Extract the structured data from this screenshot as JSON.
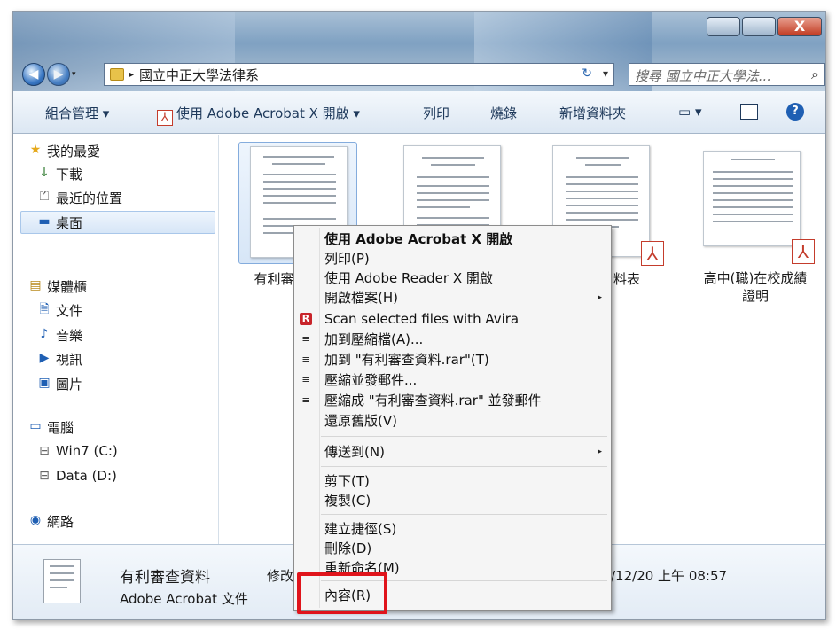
{
  "window": {
    "nav": {
      "back": "◀",
      "forward": "▶"
    },
    "address": {
      "arrow": "▸",
      "path": "國立中正大學法律系",
      "refresh": "↻",
      "dropdown": "▾"
    },
    "search": {
      "placeholder": "搜尋 國立中正大學法...",
      "icon": "search-icon",
      "glyph": "⌕"
    },
    "controls": {
      "minimize": "",
      "maximize": "",
      "close": "X"
    }
  },
  "toolbar": {
    "organize": "組合管理 ▾",
    "open_with": "使用 Adobe Acrobat X 開啟 ▾",
    "pdf_glyph": "⅄",
    "print": "列印",
    "burn": "燒錄",
    "new_folder": "新增資料夾",
    "views": "▭ ▾",
    "help": "?"
  },
  "sidebar": {
    "favorites": {
      "label": "我的最愛",
      "icon": "star-icon",
      "glyph": "★"
    },
    "downloads": {
      "label": "下載",
      "glyph": "↓"
    },
    "recent": {
      "label": "最近的位置",
      "glyph": "⏍"
    },
    "desktop": {
      "label": "桌面",
      "glyph": "▬"
    },
    "libraries": {
      "label": "媒體櫃",
      "glyph": "▤"
    },
    "documents": {
      "label": "文件",
      "glyph": "🗎"
    },
    "music": {
      "label": "音樂",
      "glyph": "♪"
    },
    "videos": {
      "label": "視訊",
      "glyph": "▶"
    },
    "pictures": {
      "label": "圖片",
      "glyph": "▣"
    },
    "computer": {
      "label": "電腦",
      "glyph": "▭"
    },
    "drive_c": {
      "label": "Win7 (C:)",
      "glyph": "⊟"
    },
    "drive_d": {
      "label": "Data (D:)",
      "glyph": "⊟"
    },
    "network": {
      "label": "網路",
      "glyph": "◉"
    }
  },
  "files": [
    {
      "label": "有利審",
      "selected": true
    },
    {
      "label": "",
      "selected": false
    },
    {
      "label": "料表",
      "selected": false
    },
    {
      "label_line1": "高中(職)在校成績",
      "label_line2": "證明",
      "selected": false
    }
  ],
  "pdf_badge": "⅄",
  "details": {
    "name": "有利審查資料",
    "type": "Adobe Acrobat 文件",
    "modified_label": "修改",
    "date": "/12/20 上午 08:57"
  },
  "context_menu": {
    "open_acrobat": "使用 Adobe Acrobat X 開啟",
    "print": "列印(P)",
    "open_reader": "使用 Adobe Reader X 開啟",
    "open_with": "開啟檔案(H)",
    "avira": "Scan selected files with Avira",
    "add_archive": "加到壓縮檔(A)...",
    "add_rar": "加到 \"有利審查資料.rar\"(T)",
    "compress_email": "壓縮並發郵件...",
    "compress_rar_email": "壓縮成 \"有利審查資料.rar\" 並發郵件",
    "restore": "還原舊版(V)",
    "send_to": "傳送到(N)",
    "cut": "剪下(T)",
    "copy": "複製(C)",
    "shortcut": "建立捷徑(S)",
    "delete": "刪除(D)",
    "rename": "重新命名(M)",
    "properties": "內容(R)",
    "submenu_arrow": "▸",
    "avira_glyph": "R",
    "rar_glyph": "≡"
  },
  "accent": {
    "highlight": "#e0141b",
    "pdf": "#c43c2c"
  }
}
